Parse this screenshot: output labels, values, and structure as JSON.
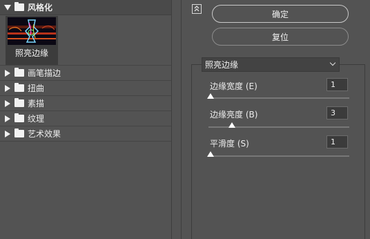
{
  "left_panel": {
    "open_category": "风格化",
    "thumbnail_label": "照亮边缘",
    "categories": [
      "画笔描边",
      "扭曲",
      "素描",
      "纹理",
      "艺术效果"
    ]
  },
  "buttons": {
    "ok": "确定",
    "reset": "复位"
  },
  "filter_select": {
    "value": "照亮边缘"
  },
  "params": [
    {
      "label": "边缘宽度 (E)",
      "value": "1",
      "slider_fraction": 0.0
    },
    {
      "label": "边缘亮度 (B)",
      "value": "3",
      "slider_fraction": 0.15
    },
    {
      "label": "平滑度 (S)",
      "value": "1",
      "slider_fraction": 0.0
    }
  ],
  "icons": {
    "collapse": "collapse-icon",
    "folder": "folder-icon",
    "expand_triangle": "triangle-right-icon",
    "collapse_triangle": "triangle-down-icon",
    "dropdown": "chevron-down-icon"
  }
}
